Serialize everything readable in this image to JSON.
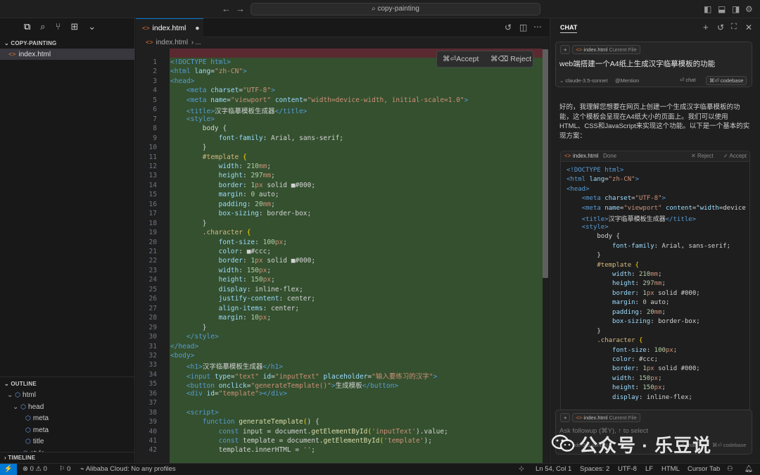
{
  "title_bar": {
    "search_text": "copy-painting"
  },
  "sidebar": {
    "explorer_header": "COPY-PAINTING",
    "file": "index.html",
    "outline_header": "OUTLINE",
    "outline_items": [
      "html",
      "head",
      "meta",
      "meta",
      "title",
      "style"
    ],
    "timeline_header": "TIMELINE"
  },
  "editor": {
    "tab_label": "index.html",
    "breadcrumb_file": "index.html",
    "breadcrumb_more": "...",
    "accept_label": "⌘⏎Accept",
    "reject_label": "⌘⌫ Reject",
    "lines": [
      "<!DOCTYPE html>",
      "<html lang=\"zh-CN\">",
      "<head>",
      "    <meta charset=\"UTF-8\">",
      "    <meta name=\"viewport\" content=\"width=device-width, initial-scale=1.0\">",
      "    <title>汉字临摹模板生成器</title>",
      "    <style>",
      "        body {",
      "            font-family: Arial, sans-serif;",
      "        }",
      "        #template {",
      "            width: 210mm;",
      "            height: 297mm;",
      "            border: 1px solid ■#000;",
      "            margin: 0 auto;",
      "            padding: 20mm;",
      "            box-sizing: border-box;",
      "        }",
      "        .character {",
      "            font-size: 100px;",
      "            color: ■#ccc;",
      "            border: 1px solid ■#000;",
      "            width: 150px;",
      "            height: 150px;",
      "            display: inline-flex;",
      "            justify-content: center;",
      "            align-items: center;",
      "            margin: 10px;",
      "        }",
      "    </style>",
      "</head>",
      "<body>",
      "    <h1>汉字临摹模板生成器</h1>",
      "    <input type=\"text\" id=\"inputText\" placeholder=\"输入要练习的汉字\">",
      "    <button onclick=\"generateTemplate()\">生成模板</button>",
      "    <div id=\"template\"></div>",
      "",
      "    <script>",
      "        function generateTemplate() {",
      "            const input = document.getElementById('inputText').value;",
      "            const template = document.getElementById('template');",
      "            template.innerHTML = '';"
    ]
  },
  "chat": {
    "header": "CHAT",
    "context_file": "index.html",
    "context_tag": "Current File",
    "user_message": "web端搭建一个A4纸上生成汉字临摹模板的功能",
    "model": "claude-3.5-sonnet",
    "mention": "Mention",
    "chat_btn": "⏎ chat",
    "codebase_btn": "⌘⏎ codebase",
    "reply": "好的，我理解您想要在网页上创建一个生成汉字临摹模板的功能，这个模板会呈现在A4纸大小的页面上。我们可以使用HTML、CSS和JavaScript来实现这个功能。以下是一个基本的实现方案：",
    "code_file": "index.html",
    "code_status": "Done",
    "code_reject": "Reject",
    "code_accept": "Accept",
    "code_lines": [
      "<!DOCTYPE html>",
      "<html lang=\"zh-CN\">",
      "<head>",
      "    <meta charset=\"UTF-8\">",
      "    <meta name=\"viewport\" content=\"width=device",
      "    <title>汉字临摹模板生成器</title>",
      "    <style>",
      "        body {",
      "            font-family: Arial, sans-serif;",
      "        }",
      "        #template {",
      "            width: 210mm;",
      "            height: 297mm;",
      "            border: 1px solid #000;",
      "            margin: 0 auto;",
      "            padding: 20mm;",
      "            box-sizing: border-box;",
      "        }",
      "        .character {",
      "            font-size: 100px;",
      "            color: #ccc;",
      "            border: 1px solid #000;",
      "            width: 150px;",
      "            height: 150px;",
      "            display: inline-flex;"
    ],
    "followup_placeholder": "Ask followup (⌘Y), ↑ to select",
    "followup_model": "claude-3.5-sonnet",
    "followup_chat": "chat",
    "followup_codebase": "codebase"
  },
  "watermark": "公众号 · 乐豆说",
  "status_bar": {
    "problems": "⊗ 0 ⚠ 0",
    "ports": "⚐ 0",
    "cloud": "Alibaba Cloud: No any profiles",
    "position": "Ln 54, Col 1",
    "spaces": "Spaces: 2",
    "encoding": "UTF-8",
    "eol": "LF",
    "language": "HTML",
    "tab_mode": "Cursor Tab"
  }
}
